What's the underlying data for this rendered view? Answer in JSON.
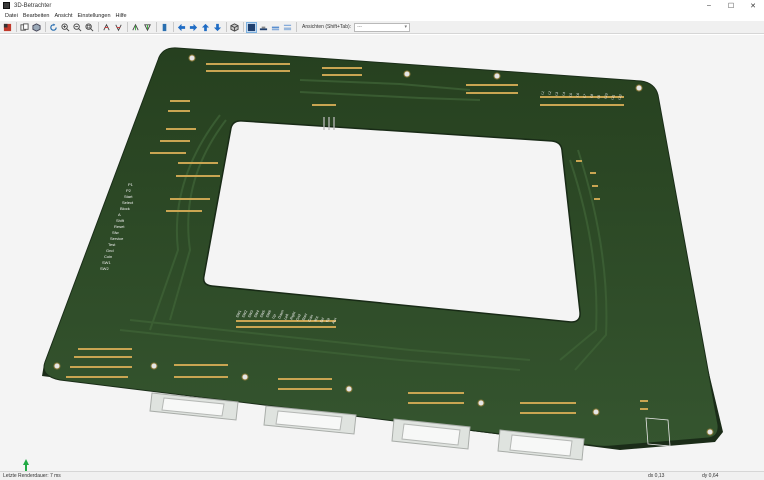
{
  "window": {
    "title": "3D-Betrachter",
    "minimize": "–",
    "maximize": "☐",
    "close": "✕"
  },
  "menu": [
    "Datei",
    "Bearbeiten",
    "Ansicht",
    "Einstellungen",
    "Hilfe"
  ],
  "toolbar": {
    "render_label": "Ansichten (Shift+Tab):",
    "render_select_value": "---"
  },
  "board": {
    "left_labels": [
      "P1",
      "P2",
      "Start",
      "Select",
      "Block",
      "A",
      "Shift",
      "Reset",
      "Sfw",
      "Service",
      "Test",
      "Gnd",
      "Coin",
      "SW1",
      "SW2"
    ],
    "center_labels": [
      "SW1",
      "SW2",
      "SW3",
      "SW4",
      "SW5",
      "SW6",
      "Up",
      "Down",
      "Left",
      "Right",
      "Gnd",
      "Start",
      "Coin",
      "Vcc",
      "Sel",
      "Tilt",
      "Aux"
    ],
    "right_labels": [
      "L1",
      "L2",
      "L3",
      "L4",
      "L5",
      "L6",
      "L7",
      "L8",
      "L9",
      "L10",
      "L11",
      "L12"
    ]
  },
  "status": {
    "message": "Letzte Renderdauer: 7 ms",
    "dx": "dx 0,13",
    "dy": "dy 0,64"
  },
  "colors": {
    "pcb": "#2f4a2c",
    "pcb_edge": "#1f3320",
    "pad": "#c9a552",
    "silk": "#f2f2f2",
    "connector": "#e9ece9"
  }
}
